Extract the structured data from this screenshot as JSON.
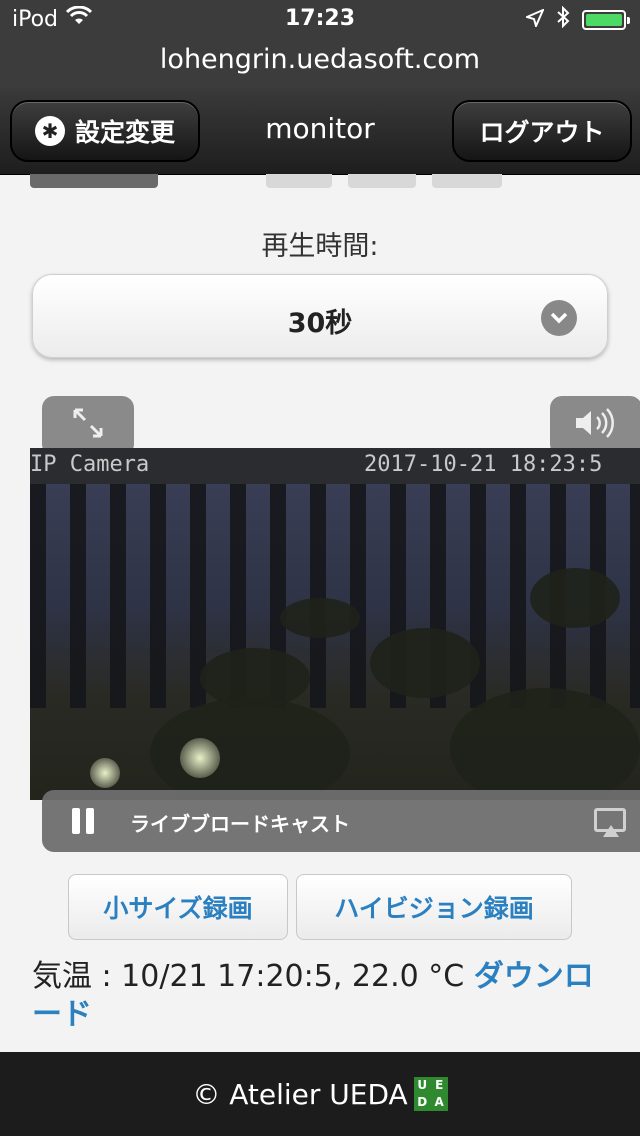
{
  "status_bar": {
    "carrier": "iPod",
    "time": "17:23"
  },
  "browser": {
    "url": "lohengrin.uedasoft.com"
  },
  "header": {
    "settings_label": "設定変更",
    "title": "monitor",
    "logout_label": "ログアウト"
  },
  "playback": {
    "label": "再生時間:",
    "selected": "30秒"
  },
  "video": {
    "osd_left": "IP Camera",
    "osd_right": "2017-10-21 18:23:5"
  },
  "player": {
    "label": "ライブブロードキャスト"
  },
  "buttons": {
    "small_record": "小サイズ録画",
    "hd_record": "ハイビジョン録画"
  },
  "temperature": {
    "text": "気温 : 10/21 17:20:5, 22.0 °C ",
    "download_link": "ダウンロード"
  },
  "footer": {
    "copyright": "© Atelier UEDA",
    "logo_text": [
      "U",
      "E",
      "D",
      "A"
    ]
  },
  "colors": {
    "link": "#2a80c0",
    "battery": "#4cd964",
    "logo": "#2f8a2f"
  }
}
